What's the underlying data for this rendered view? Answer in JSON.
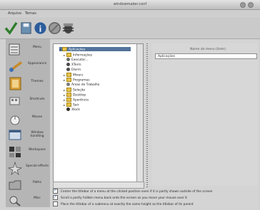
{
  "window": {
    "title": "windowmaker.conf"
  },
  "menubar": {
    "items": [
      "Arquivo",
      "Temas"
    ]
  },
  "sidebar": {
    "items": [
      {
        "label": "Menu",
        "icon": "menu-icon"
      },
      {
        "label": "Appearance",
        "icon": "appearance-icon"
      },
      {
        "label": "Themes",
        "icon": "themes-icon"
      },
      {
        "label": "Shortcuts",
        "icon": "shortcuts-icon"
      },
      {
        "label": "Mouse",
        "icon": "mouse-icon"
      },
      {
        "label": "Window handling",
        "icon": "window-handling-icon"
      },
      {
        "label": "Workspace",
        "icon": "workspace-icon"
      },
      {
        "label": "Special effects",
        "icon": "special-effects-icon"
      },
      {
        "label": "Paths",
        "icon": "paths-icon"
      },
      {
        "label": "Misc",
        "icon": "misc-icon"
      }
    ]
  },
  "tree": {
    "root": "Aplicações",
    "items": [
      {
        "label": "Informações",
        "type": "folder"
      },
      {
        "label": "Executar...",
        "type": "item"
      },
      {
        "label": "XTerm",
        "type": "item"
      },
      {
        "label": "Eterm",
        "type": "item"
      },
      {
        "label": "Mixers",
        "type": "folder"
      },
      {
        "label": "Programas",
        "type": "folder"
      },
      {
        "label": "Áreas de Trabalho",
        "type": "item"
      },
      {
        "label": "Seleção",
        "type": "folder"
      },
      {
        "label": "Desktop",
        "type": "folder"
      },
      {
        "label": "Aparência",
        "type": "folder"
      },
      {
        "label": "Sair",
        "type": "folder"
      },
      {
        "label": "Xlock",
        "type": "item"
      }
    ]
  },
  "details": {
    "header": "Nome do menu (item)",
    "value": "Aplicações"
  },
  "options": [
    {
      "label": "Center the titlebar of a menu at the clicked position even if it is partly shown outside of the screen",
      "checked": true
    },
    {
      "label": "Scroll a partly hidden menu back onto the screen as you move your mouse over it",
      "checked": true
    },
    {
      "label": "Place the titlebar of a submenu at exactly the same height as the titlebar of its parent",
      "checked": false
    }
  ]
}
